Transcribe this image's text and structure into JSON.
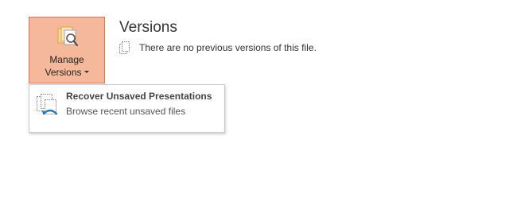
{
  "manage_versions": {
    "label_line1": "Manage",
    "label_line2": "Versions",
    "icon": "manage-versions-icon"
  },
  "versions": {
    "title": "Versions",
    "info_text": "There are no previous versions of this file.",
    "info_icon": "document-icon"
  },
  "dropdown": {
    "items": [
      {
        "title": "Recover Unsaved Presentations",
        "description": "Browse recent unsaved files",
        "icon": "recover-unsaved-icon"
      }
    ]
  },
  "colors": {
    "button_bg": "#f6b89b",
    "button_border": "#e0714d",
    "icon_gold": "#e8b450",
    "icon_blue": "#2e75b6"
  }
}
